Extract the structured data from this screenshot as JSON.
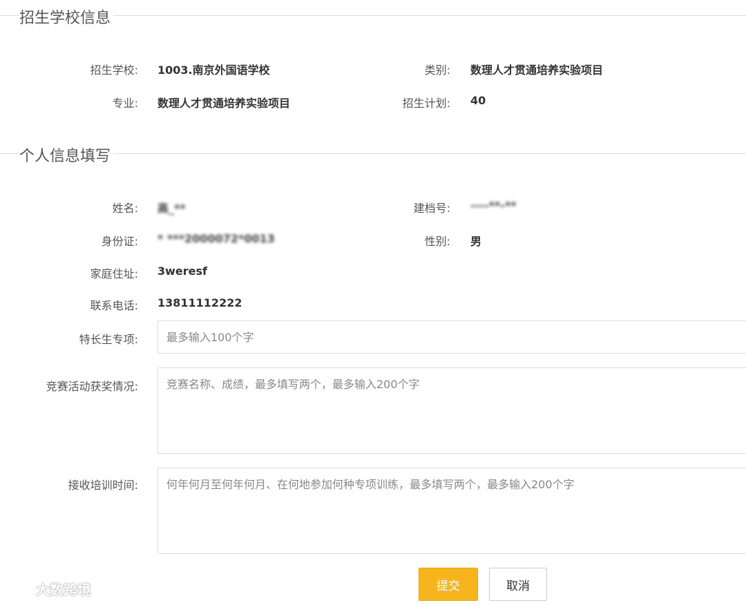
{
  "school_section": {
    "title": "招生学校信息",
    "school_label": "招生学校:",
    "school_value": "1003.南京外国语学校",
    "category_label": "类别:",
    "category_value": "数理人才贯通培养实验项目",
    "major_label": "专业:",
    "major_value": "数理人才贯通培养实验项目",
    "plan_label": "招生计划:",
    "plan_value": "40"
  },
  "personal_section": {
    "title": "个人信息填写",
    "name_label": "姓名:",
    "name_value": "高_**",
    "file_no_label": "建档号:",
    "file_no_value": "----**-**",
    "id_label": "身份证:",
    "id_value": "*  ***2000072*0013",
    "gender_label": "性别:",
    "gender_value": "男",
    "address_label": "家庭住址:",
    "address_value": "3weresf",
    "phone_label": "联系电话:",
    "phone_value": "13811112222",
    "specialty_label": "特长生专项:",
    "specialty_placeholder": "最多输入100个字",
    "competition_label": "竞赛活动获奖情况:",
    "competition_placeholder": "竞赛名称、成绩，最多填写两个，最多输入200个字",
    "training_label": "接收培训时间:",
    "training_placeholder": "何年何月至何年何月、在何地参加何种专项训练，最多填写两个，最多输入200个字"
  },
  "actions": {
    "submit_label": "提交",
    "cancel_label": "取消"
  },
  "watermark": {
    "text": "大数跨境",
    "icon": "logo-icon"
  },
  "colors": {
    "submit_bg": "#f7b51d",
    "border": "#dddddd",
    "label": "#555555"
  }
}
